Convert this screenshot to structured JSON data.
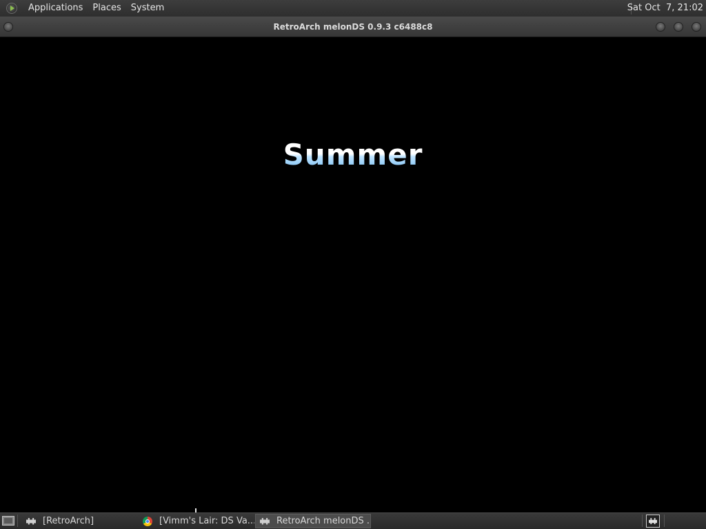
{
  "top_panel": {
    "menus": [
      "Applications",
      "Places",
      "System"
    ],
    "clock": "Sat Oct  7, 21:02"
  },
  "window": {
    "title": "RetroArch melonDS 0.9.3 c6488c8",
    "content_text": "Summer"
  },
  "taskbar": {
    "tasks": [
      {
        "label": "[RetroArch]",
        "icon": "retroarch-icon",
        "active": false
      },
      {
        "label": "[Vimm's Lair: DS Va...",
        "icon": "chrome-icon",
        "active": false
      },
      {
        "label": "RetroArch melonDS ...",
        "icon": "retroarch-icon",
        "active": true
      }
    ],
    "tray_icon": "retroarch-tray-icon"
  }
}
